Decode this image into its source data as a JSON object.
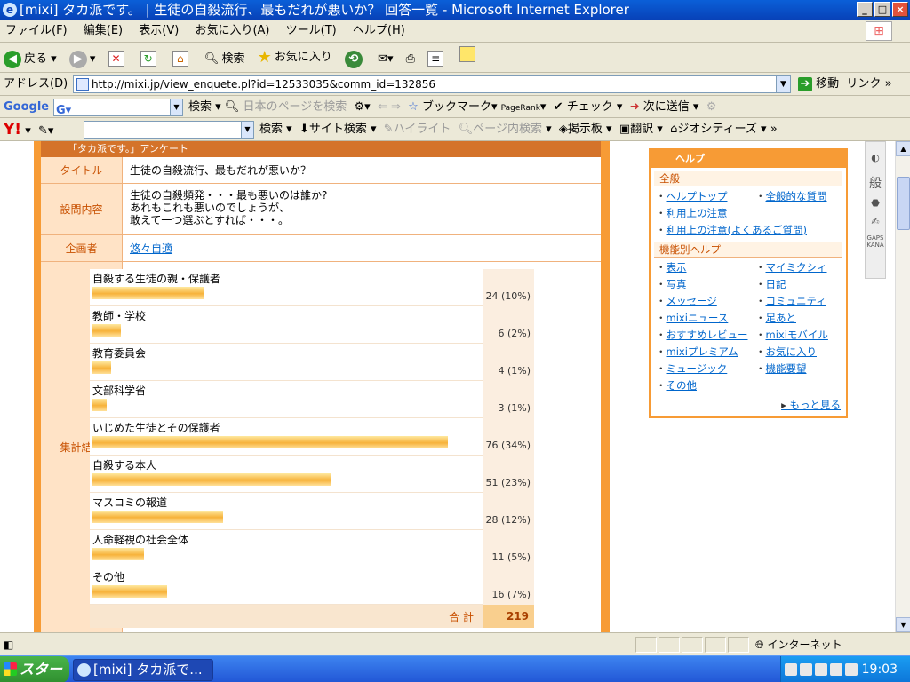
{
  "window": {
    "title": "[mixi] タカ派です。 | 生徒の自殺流行、最もだれが悪いか？ 回答一覧 - Microsoft Internet Explorer"
  },
  "menu": [
    "ファイル(F)",
    "編集(E)",
    "表示(V)",
    "お気に入り(A)",
    "ツール(T)",
    "ヘルプ(H)"
  ],
  "toolbar": {
    "back": "戻る",
    "search": "検索",
    "favorites": "お気に入り"
  },
  "address": {
    "label": "アドレス(D)",
    "url": "http://mixi.jp/view_enquete.pl?id=12533035&comm_id=132856",
    "go": "移動",
    "links": "リンク"
  },
  "google": {
    "logo": "Google",
    "search": "検索",
    "japanese_pages": "日本のページを検索",
    "bookmarks": "ブックマーク",
    "pagerank": "PageRank",
    "check": "チェック",
    "send": "次に送信"
  },
  "yahoo": {
    "logo": "Y!",
    "search": "検索",
    "site_search": "サイト検索",
    "highlight": "ハイライト",
    "in_page": "ページ内検索",
    "board": "掲示板",
    "translate": "翻訳",
    "geocities": "ジオシティーズ"
  },
  "enquete": {
    "header": "「タカ派です。」アンケート",
    "title_label": "タイトル",
    "title": "生徒の自殺流行、最もだれが悪いか？",
    "question_label": "設問内容",
    "question": [
      "生徒の自殺頻発・・・最も悪いのは誰か?",
      "あれもこれも悪いのでしょうが、",
      "敢えて一つ選ぶとすれば・・・。"
    ],
    "author_label": "企画者",
    "author": "悠々自適",
    "results_label": "集計結果",
    "results": [
      {
        "name": "自殺する生徒の親・保護者",
        "count": "24 (10%)",
        "value": 24
      },
      {
        "name": "教師・学校",
        "count": "6 (2%)",
        "value": 6
      },
      {
        "name": "教育委員会",
        "count": "4 (1%)",
        "value": 4
      },
      {
        "name": "文部科学省",
        "count": "3 (1%)",
        "value": 3
      },
      {
        "name": "いじめた生徒とその保護者",
        "count": "76 (34%)",
        "value": 76
      },
      {
        "name": "自殺する本人",
        "count": "51 (23%)",
        "value": 51
      },
      {
        "name": "マスコミの報道",
        "count": "28 (12%)",
        "value": 28
      },
      {
        "name": "人命軽視の社会全体",
        "count": "11 (5%)",
        "value": 11
      },
      {
        "name": "その他",
        "count": "16 (7%)",
        "value": 16
      }
    ],
    "total_label": "合 計",
    "total": "219"
  },
  "help": {
    "title": "ヘルプ",
    "general_label": "全般",
    "general": [
      "ヘルプトップ",
      "全般的な質問",
      "利用上の注意",
      "",
      "利用上の注意(よくあるご質問)",
      ""
    ],
    "feature_label": "機能別ヘルプ",
    "features": [
      "表示",
      "マイミクシィ",
      "写真",
      "日記",
      "メッセージ",
      "コミュニティ",
      "mixiニュース",
      "足あと",
      "おすすめレビュー",
      "mixiモバイル",
      "mixiプレミアム",
      "お気に入り",
      "ミュージック",
      "機能要望",
      "その他",
      ""
    ],
    "more": "もっと見る"
  },
  "side_panel": {
    "text": "般",
    "kana": "GAPS KANA"
  },
  "status": {
    "zone": "インターネット"
  },
  "taskbar": {
    "start": "スタート",
    "task": "[mixi] タカ派で...",
    "clock": "19:03"
  }
}
